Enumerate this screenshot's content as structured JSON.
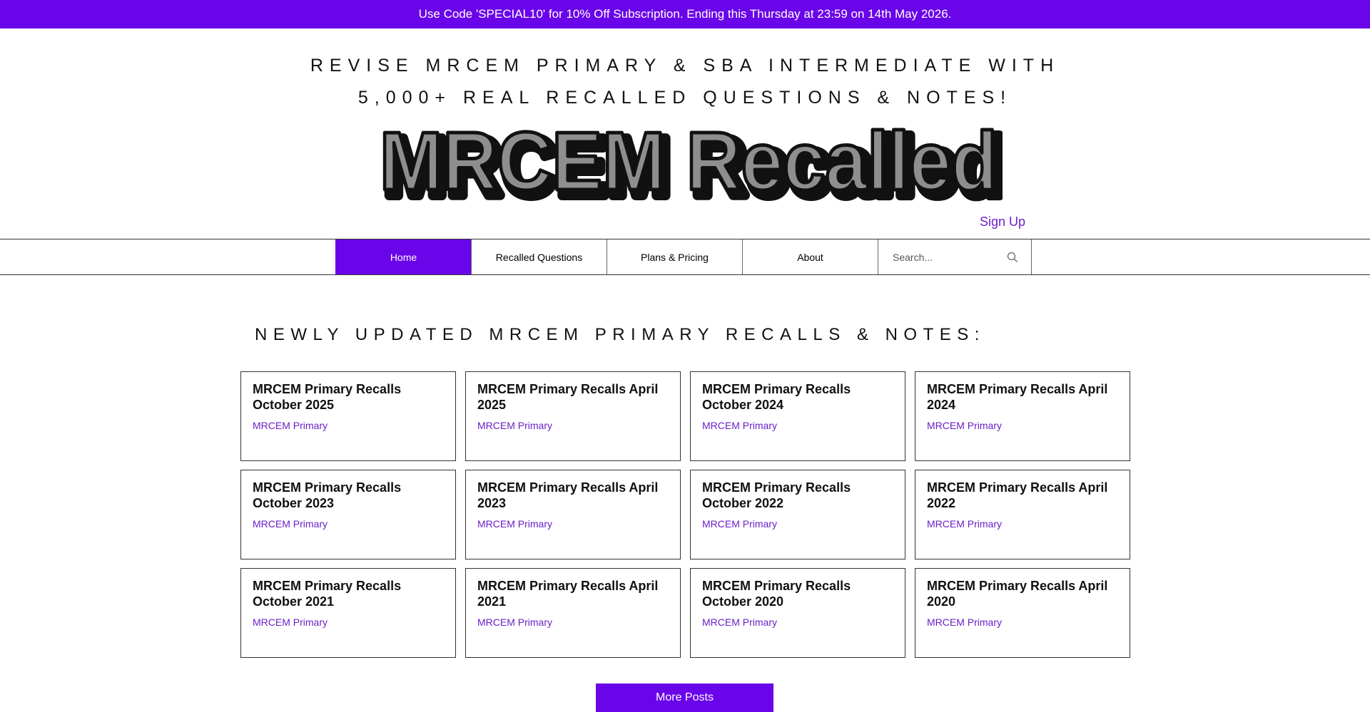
{
  "promo_banner": {
    "text": "Use Code 'SPECIAL10' for 10% Off Subscription. Ending this Thursday at 23:59 on 14th May 2026."
  },
  "header": {
    "tagline_line1": "REVISE MRCEM PRIMARY & SBA INTERMEDIATE WITH",
    "tagline_line2": "5,000+ REAL RECALLED QUESTIONS & NOTES!",
    "logo_text": "MRCEM Recalled",
    "signup_label": "Sign Up"
  },
  "nav": {
    "items": [
      {
        "label": "Home",
        "active": true
      },
      {
        "label": "Recalled Questions",
        "active": false
      },
      {
        "label": "Plans & Pricing",
        "active": false
      },
      {
        "label": "About",
        "active": false
      }
    ],
    "search_placeholder": "Search...",
    "search_icon": "search-icon"
  },
  "main": {
    "heading": "NEWLY UPDATED MRCEM PRIMARY RECALLS & NOTES:",
    "posts": [
      {
        "title": "MRCEM Primary Recalls October 2025",
        "category": "MRCEM Primary"
      },
      {
        "title": "MRCEM Primary Recalls April 2025",
        "category": "MRCEM Primary"
      },
      {
        "title": "MRCEM Primary Recalls October 2024",
        "category": "MRCEM Primary"
      },
      {
        "title": "MRCEM Primary Recalls April 2024",
        "category": "MRCEM Primary"
      },
      {
        "title": "MRCEM Primary Recalls October 2023",
        "category": "MRCEM Primary"
      },
      {
        "title": "MRCEM Primary Recalls April 2023",
        "category": "MRCEM Primary"
      },
      {
        "title": "MRCEM Primary Recalls October 2022",
        "category": "MRCEM Primary"
      },
      {
        "title": "MRCEM Primary Recalls April 2022",
        "category": "MRCEM Primary"
      },
      {
        "title": "MRCEM Primary Recalls October 2021",
        "category": "MRCEM Primary"
      },
      {
        "title": "MRCEM Primary Recalls April 2021",
        "category": "MRCEM Primary"
      },
      {
        "title": "MRCEM Primary Recalls October 2020",
        "category": "MRCEM Primary"
      },
      {
        "title": "MRCEM Primary Recalls April 2020",
        "category": "MRCEM Primary"
      }
    ],
    "more_posts_label": "More Posts"
  },
  "colors": {
    "accent": "#6a05ea",
    "link": "#6a1fc9",
    "logo_fill": "#8e8e8e"
  }
}
